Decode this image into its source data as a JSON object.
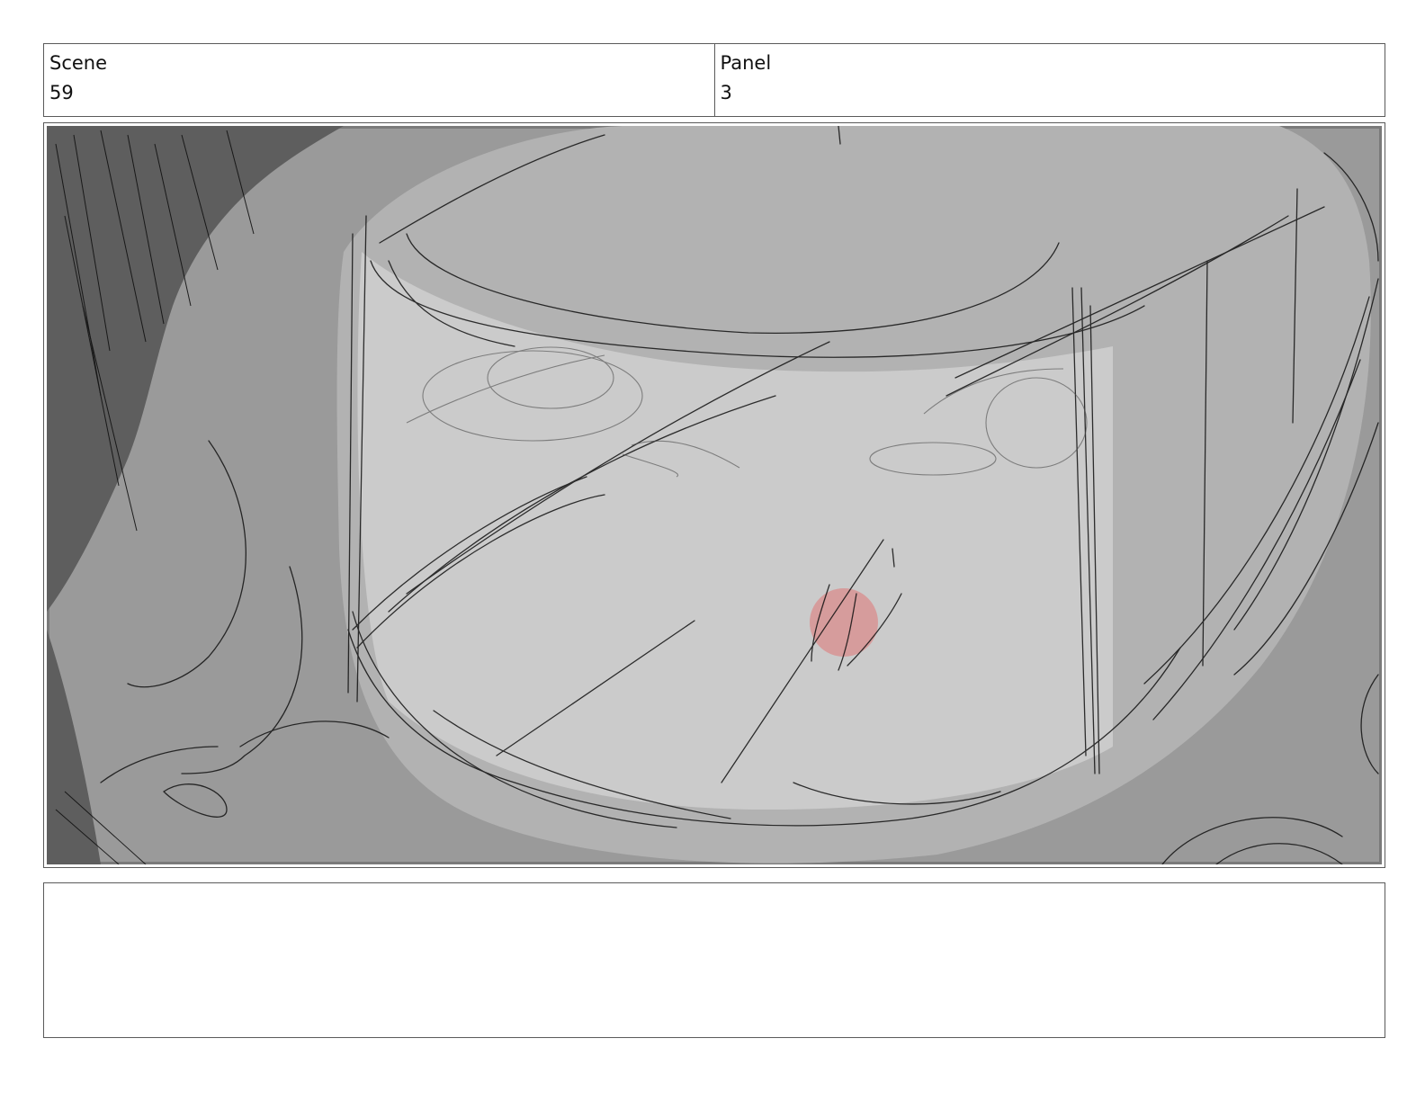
{
  "header": {
    "scene_label": "Scene",
    "scene_value": "59",
    "panel_label": "Panel",
    "panel_value": "3"
  },
  "panel_image": {
    "description_icon": "storyboard-sketch",
    "colors": {
      "background_dark": "#9a9a9a",
      "shadow": "#5e5e5e",
      "helmet": "#b2b2b2",
      "face": "#cbcbcb",
      "blush": "#d98c8c",
      "line": "#111111"
    }
  },
  "notes": {
    "text": ""
  }
}
